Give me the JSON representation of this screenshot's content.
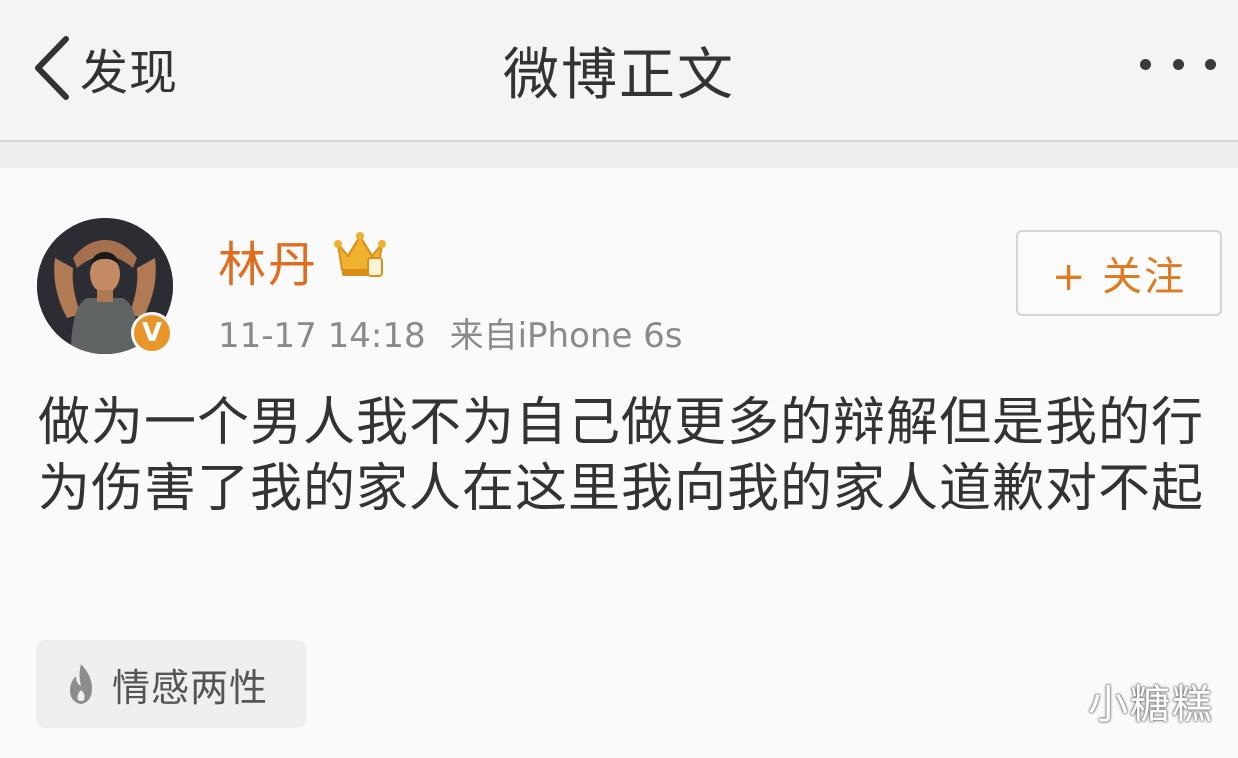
{
  "navbar": {
    "back_label": "发现",
    "title": "微博正文",
    "back_icon": "chevron-left-icon",
    "more_icon": "more-dots-icon"
  },
  "post": {
    "username": "林丹",
    "verified_badge": "V",
    "timestamp": "11-17 14:18",
    "source": "来自iPhone 6s",
    "follow_label": "+ 关注",
    "text": "做为一个男人我不为自己做更多的辩解但是我的行为伤害了我的家人在这里我向我的家人道歉对不起",
    "tag_label": "情感两性"
  },
  "watermark": "小糖糕",
  "colors": {
    "username": "#e06d1f",
    "follow": "#e07a22",
    "badge": "#e8952a"
  }
}
